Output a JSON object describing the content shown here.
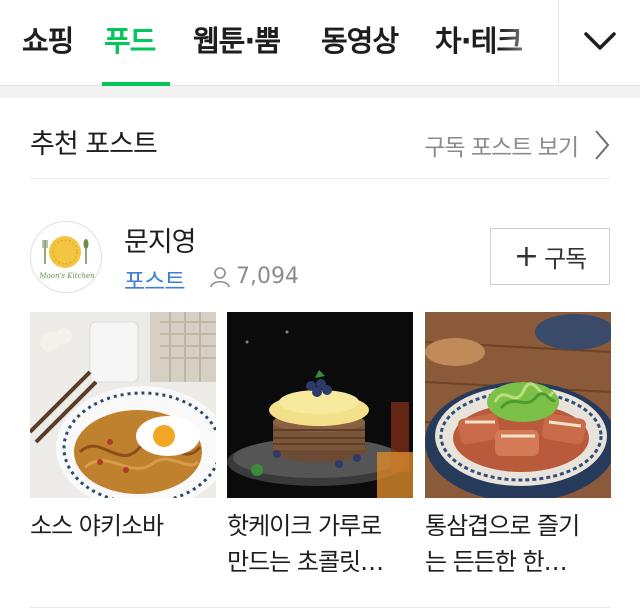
{
  "tabs": [
    {
      "label": "쇼핑",
      "active": false
    },
    {
      "label": "푸드",
      "active": true
    },
    {
      "label": "웹툰·뿜",
      "active": false
    },
    {
      "label": "동영상",
      "active": false
    },
    {
      "label": "차·테크",
      "active": false
    }
  ],
  "accent_color": "#03c75a",
  "more_icon": "chevron-down-icon",
  "section": {
    "title": "추천 포스트",
    "subscribed_link": "구독 포스트 보기"
  },
  "author": {
    "name": "문지영",
    "post_label": "포스트",
    "subscriber_count": "7,094",
    "subscriber_icon": "person-icon",
    "subscribe_label": "구독",
    "avatar_text": "Moon's Kitchen"
  },
  "posts": [
    {
      "title_line1": "소스 야키소바",
      "title_line2": ""
    },
    {
      "title_line1": "핫케이크 가루로",
      "title_line2": "만드는 초콜릿…"
    },
    {
      "title_line1": "통삼겹으로 즐기",
      "title_line2": "는 든든한 한…"
    }
  ]
}
